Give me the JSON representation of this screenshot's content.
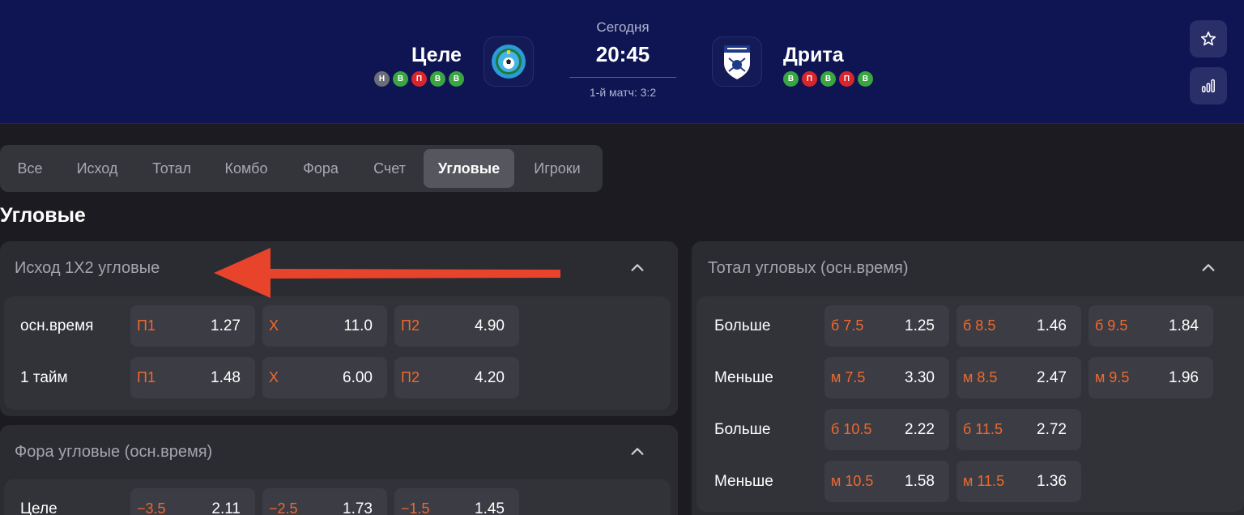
{
  "match": {
    "home": {
      "name": "Целе",
      "form": [
        "Н",
        "В",
        "П",
        "В",
        "В"
      ]
    },
    "away": {
      "name": "Дрита",
      "form": [
        "В",
        "П",
        "В",
        "П",
        "В"
      ]
    },
    "day": "Сегодня",
    "time": "20:45",
    "first_match": "1-й матч: 3:2"
  },
  "tabs": [
    "Все",
    "Исход",
    "Тотал",
    "Комбо",
    "Фора",
    "Счет",
    "Угловые",
    "Игроки"
  ],
  "active_tab": "Угловые",
  "section_title": "Угловые",
  "cards": {
    "outcome": {
      "title": "Исход 1X2 угловые",
      "rows": [
        {
          "label": "осн.время",
          "odds": [
            {
              "k": "П1",
              "v": "1.27"
            },
            {
              "k": "Х",
              "v": "11.0"
            },
            {
              "k": "П2",
              "v": "4.90"
            }
          ]
        },
        {
          "label": "1 тайм",
          "odds": [
            {
              "k": "П1",
              "v": "1.48"
            },
            {
              "k": "Х",
              "v": "6.00"
            },
            {
              "k": "П2",
              "v": "4.20"
            }
          ]
        }
      ]
    },
    "handicap": {
      "title": "Фора угловые (осн.время)",
      "rows": [
        {
          "label": "Целе",
          "odds": [
            {
              "k": "−3.5",
              "v": "2.11"
            },
            {
              "k": "−2.5",
              "v": "1.73"
            },
            {
              "k": "−1.5",
              "v": "1.45"
            }
          ]
        }
      ]
    },
    "total": {
      "title": "Тотал угловых (осн.время)",
      "rows": [
        {
          "label": "Больше",
          "odds": [
            {
              "k": "б 7.5",
              "v": "1.25"
            },
            {
              "k": "б 8.5",
              "v": "1.46"
            },
            {
              "k": "б 9.5",
              "v": "1.84"
            }
          ]
        },
        {
          "label": "Меньше",
          "odds": [
            {
              "k": "м 7.5",
              "v": "3.30"
            },
            {
              "k": "м 8.5",
              "v": "2.47"
            },
            {
              "k": "м 9.5",
              "v": "1.96"
            }
          ]
        },
        {
          "label": "Больше",
          "odds": [
            {
              "k": "б 10.5",
              "v": "2.22"
            },
            {
              "k": "б 11.5",
              "v": "2.72"
            }
          ]
        },
        {
          "label": "Меньше",
          "odds": [
            {
              "k": "м 10.5",
              "v": "1.58"
            },
            {
              "k": "м 11.5",
              "v": "1.36"
            }
          ]
        }
      ]
    }
  },
  "colors": {
    "header_bg": "#0e1552",
    "page_bg": "#1c1b21",
    "accent_orange": "#ee6a2e",
    "form_win": "#3aa642",
    "form_loss": "#d8262d",
    "form_draw": "#6b6e7a",
    "annotation_arrow": "#e8432b"
  },
  "icons": {
    "favorite": "star-icon",
    "stats": "stats-bars-icon",
    "collapse": "chevron-up-icon",
    "annotation": "red-arrow-annotation"
  }
}
